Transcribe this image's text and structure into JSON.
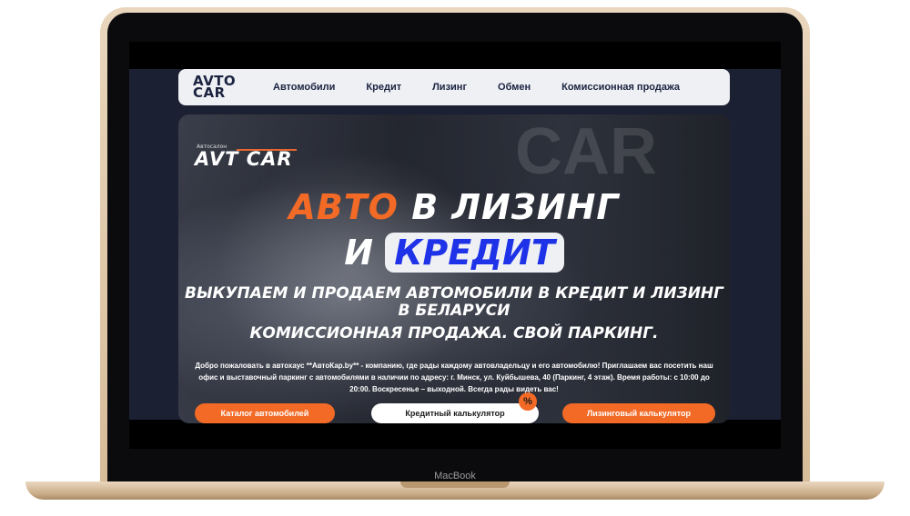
{
  "device": {
    "brand_label": "MacBook"
  },
  "nav": {
    "logo_line1": "AVTO",
    "logo_line2": "CAR",
    "links": [
      "Автомобили",
      "Кредит",
      "Лизинг",
      "Обмен",
      "Комиссионная продажа"
    ]
  },
  "hero": {
    "logo_small": "Автосалон",
    "logo_main": "AVT CAR",
    "bg_word": "CAR",
    "headline_orange": "АВТО",
    "headline_rest": " В ЛИЗИНГ",
    "headline_2_prefix": "И ",
    "headline_2_box": "КРЕДИТ",
    "sub_1": "ВЫКУПАЕМ И ПРОДАЕМ АВТОМОБИЛИ В КРЕДИТ И ЛИЗИНГ В БЕЛАРУСИ",
    "sub_2": "КОМИССИОННАЯ ПРОДАЖА. СВОЙ ПАРКИНГ.",
    "description": "Добро пожаловать в автохаус **АвтоКар.by** - компанию, где рады каждому автовладельцу и его автомобилю! Приглашаем вас посетить наш офис и выставочный паркинг с автомобилями в наличии по адресу: г. Минск, ул. Куйбышева, 40 (Паркинг, 4 этаж). Время работы: с 10:00 до 20:00. Воскресенье – выходной. Всегда рады видеть вас!",
    "buttons": {
      "catalog": "Каталог автомобилей",
      "credit": "Кредитный калькулятор",
      "leasing": "Лизинговый калькулятор"
    },
    "percent_badge": "%"
  },
  "colors": {
    "accent_orange": "#f26a26",
    "accent_blue": "#1e32e8",
    "nav_bg": "#eef0f4"
  }
}
